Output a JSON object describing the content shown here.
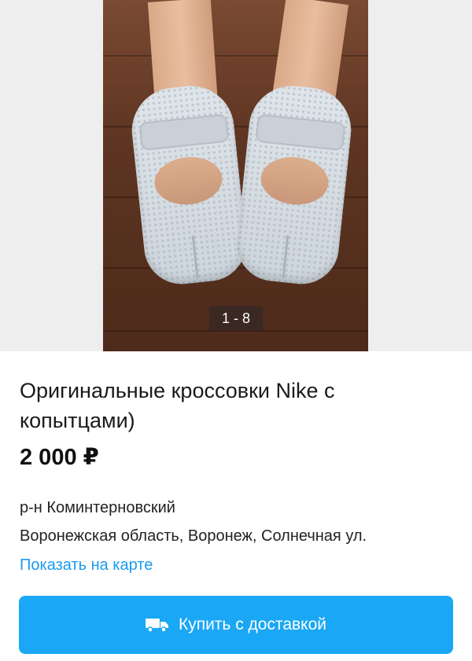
{
  "gallery": {
    "counter": "1 - 8",
    "photo_icon": "sneakers-photo"
  },
  "listing": {
    "title": "Оригинальные кроссовки Nike с копытцами)",
    "price": "2 000 ₽"
  },
  "location": {
    "district": "р-н Коминтерновский",
    "address": "Воронежская область, Воронеж, Солнечная ул.",
    "map_link": "Показать на карте"
  },
  "actions": {
    "buy_button_label": "Купить с доставкой",
    "buy_button_icon": "truck-icon"
  },
  "colors": {
    "accent": "#1aa7f5",
    "link": "#1a9bf0",
    "gallery_bg": "#eeeeee"
  }
}
